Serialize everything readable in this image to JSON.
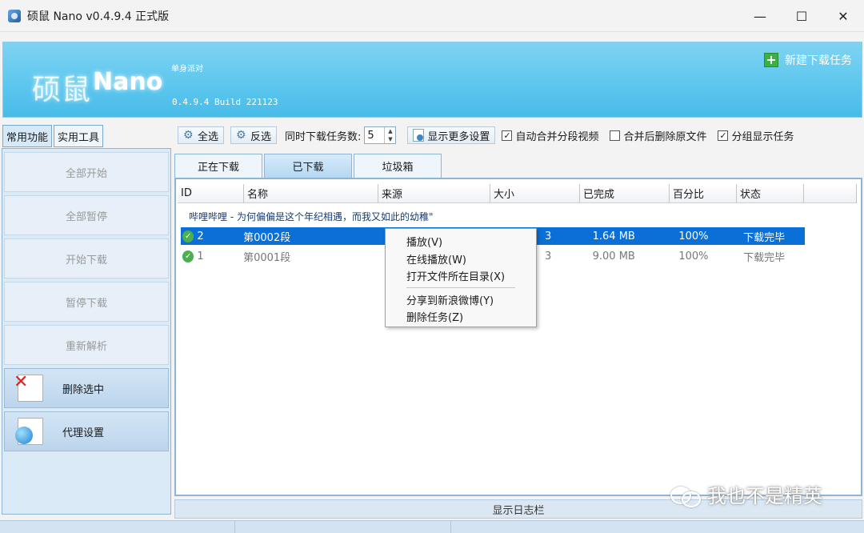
{
  "window": {
    "title": "硕鼠 Nano v0.4.9.4 正式版",
    "minimize": "—",
    "maximize": "☐",
    "close": "✕"
  },
  "banner": {
    "brand_cn": "硕鼠",
    "brand_en": "Nano",
    "slogan": "单身派对",
    "version": "0.4.9.4 Build 221123",
    "new_task": "新建下载任务"
  },
  "left_tabs": [
    "常用功能",
    "实用工具"
  ],
  "left_buttons": {
    "start_all": "全部开始",
    "pause_all": "全部暂停",
    "start": "开始下载",
    "pause": "暂停下载",
    "reparse": "重新解析",
    "delete_selected": "删除选中",
    "proxy": "代理设置"
  },
  "toolbar": {
    "select_all": "全选",
    "invert": "反选",
    "concurrent_label": "同时下载任务数:",
    "concurrent_value": "5",
    "more_settings": "显示更多设置",
    "auto_merge": "自动合并分段视频",
    "delete_after_merge": "合并后删除原文件",
    "group_display": "分组显示任务"
  },
  "checkbox_states": {
    "auto_merge": true,
    "delete_after_merge": false,
    "group_display": true
  },
  "main_tabs": [
    "正在下载",
    "已下载",
    "垃圾箱"
  ],
  "table": {
    "headers": [
      "ID",
      "名称",
      "来源",
      "大小",
      "已完成",
      "百分比",
      "状态"
    ],
    "group_title": "哔哩哔哩 - 为何偏偏是这个年纪相遇，而我又如此的幼稚\"",
    "rows": [
      {
        "id": "2",
        "name": "第0002段",
        "size_tail": "3",
        "done": "1.64 MB",
        "percent": "100%",
        "status": "下载完毕"
      },
      {
        "id": "1",
        "name": "第0001段",
        "size_tail": "3",
        "done": "9.00 MB",
        "percent": "100%",
        "status": "下载完毕"
      }
    ]
  },
  "context_menu": {
    "play": "播放(V)",
    "play_online": "在线播放(W)",
    "open_folder": "打开文件所在目录(X)",
    "share_weibo": "分享到新浪微博(Y)",
    "delete_task": "删除任务(Z)"
  },
  "log_bar": "显示日志栏",
  "watermark": "我也不是精英",
  "colors": {
    "banner": "#5bc6ee",
    "selection": "#0a6fd6",
    "panel": "#dbeaf7"
  }
}
